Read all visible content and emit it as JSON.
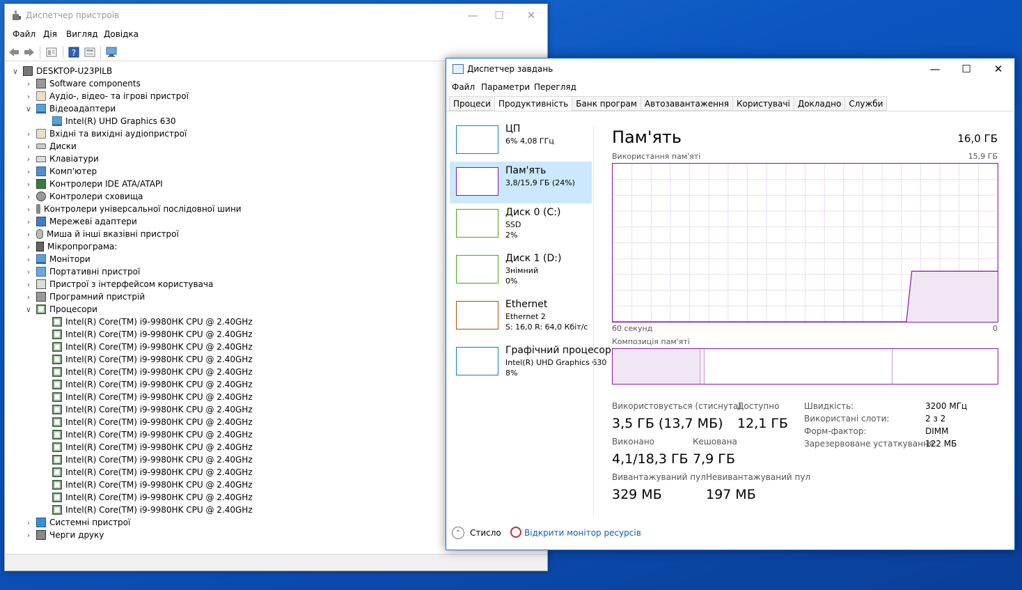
{
  "device_manager": {
    "title": "Диспетчер пристроїв",
    "menu": [
      "Файл",
      "Дія",
      "Вигляд",
      "Довідка"
    ],
    "tree": [
      {
        "label": "DESKTOP-U23PILB",
        "level": 0,
        "expanded": true,
        "icon": "computer-root-icon"
      },
      {
        "label": "Software components",
        "level": 1,
        "expanded": false,
        "icon": "software-components-icon"
      },
      {
        "label": "Аудіо-, відео- та ігрові пристрої",
        "level": 1,
        "expanded": false,
        "icon": "audio-icon"
      },
      {
        "label": "Відеоадаптери",
        "level": 1,
        "expanded": true,
        "icon": "display-adapter-icon"
      },
      {
        "label": "Intel(R) UHD Graphics 630",
        "level": 2,
        "expanded": null,
        "icon": "display-adapter-icon"
      },
      {
        "label": "Вхідні та вихідні аудіопристрої",
        "level": 1,
        "expanded": false,
        "icon": "audio-io-icon"
      },
      {
        "label": "Диски",
        "level": 1,
        "expanded": false,
        "icon": "disk-icon"
      },
      {
        "label": "Клавіатури",
        "level": 1,
        "expanded": false,
        "icon": "keyboard-icon"
      },
      {
        "label": "Комп'ютер",
        "level": 1,
        "expanded": false,
        "icon": "computer-icon"
      },
      {
        "label": "Контролери IDE ATA/ATAPI",
        "level": 1,
        "expanded": false,
        "icon": "ide-icon"
      },
      {
        "label": "Контролери сховища",
        "level": 1,
        "expanded": false,
        "icon": "storage-icon"
      },
      {
        "label": "Контролери універсальної послідовної шини",
        "level": 1,
        "expanded": false,
        "icon": "usb-icon"
      },
      {
        "label": "Мережеві адаптери",
        "level": 1,
        "expanded": false,
        "icon": "network-icon"
      },
      {
        "label": "Миша й інші вказівні пристрої",
        "level": 1,
        "expanded": false,
        "icon": "mouse-icon"
      },
      {
        "label": "Мікропрограма:",
        "level": 1,
        "expanded": false,
        "icon": "firmware-icon"
      },
      {
        "label": "Монітори",
        "level": 1,
        "expanded": false,
        "icon": "monitor-icon"
      },
      {
        "label": "Портативні пристрої",
        "level": 1,
        "expanded": false,
        "icon": "portable-icon"
      },
      {
        "label": "Пристрої з інтерфейсом користувача",
        "level": 1,
        "expanded": false,
        "icon": "hid-icon"
      },
      {
        "label": "Програмний пристрій",
        "level": 1,
        "expanded": false,
        "icon": "software-device-icon"
      },
      {
        "label": "Процесори",
        "level": 1,
        "expanded": true,
        "icon": "processor-icon"
      },
      {
        "label": "Intel(R) Core(TM) i9-9980HK CPU @ 2.40GHz",
        "level": 2,
        "expanded": null,
        "icon": "processor-icon"
      },
      {
        "label": "Intel(R) Core(TM) i9-9980HK CPU @ 2.40GHz",
        "level": 2,
        "expanded": null,
        "icon": "processor-icon"
      },
      {
        "label": "Intel(R) Core(TM) i9-9980HK CPU @ 2.40GHz",
        "level": 2,
        "expanded": null,
        "icon": "processor-icon"
      },
      {
        "label": "Intel(R) Core(TM) i9-9980HK CPU @ 2.40GHz",
        "level": 2,
        "expanded": null,
        "icon": "processor-icon"
      },
      {
        "label": "Intel(R) Core(TM) i9-9980HK CPU @ 2.40GHz",
        "level": 2,
        "expanded": null,
        "icon": "processor-icon"
      },
      {
        "label": "Intel(R) Core(TM) i9-9980HK CPU @ 2.40GHz",
        "level": 2,
        "expanded": null,
        "icon": "processor-icon"
      },
      {
        "label": "Intel(R) Core(TM) i9-9980HK CPU @ 2.40GHz",
        "level": 2,
        "expanded": null,
        "icon": "processor-icon"
      },
      {
        "label": "Intel(R) Core(TM) i9-9980HK CPU @ 2.40GHz",
        "level": 2,
        "expanded": null,
        "icon": "processor-icon"
      },
      {
        "label": "Intel(R) Core(TM) i9-9980HK CPU @ 2.40GHz",
        "level": 2,
        "expanded": null,
        "icon": "processor-icon"
      },
      {
        "label": "Intel(R) Core(TM) i9-9980HK CPU @ 2.40GHz",
        "level": 2,
        "expanded": null,
        "icon": "processor-icon"
      },
      {
        "label": "Intel(R) Core(TM) i9-9980HK CPU @ 2.40GHz",
        "level": 2,
        "expanded": null,
        "icon": "processor-icon"
      },
      {
        "label": "Intel(R) Core(TM) i9-9980HK CPU @ 2.40GHz",
        "level": 2,
        "expanded": null,
        "icon": "processor-icon"
      },
      {
        "label": "Intel(R) Core(TM) i9-9980HK CPU @ 2.40GHz",
        "level": 2,
        "expanded": null,
        "icon": "processor-icon"
      },
      {
        "label": "Intel(R) Core(TM) i9-9980HK CPU @ 2.40GHz",
        "level": 2,
        "expanded": null,
        "icon": "processor-icon"
      },
      {
        "label": "Intel(R) Core(TM) i9-9980HK CPU @ 2.40GHz",
        "level": 2,
        "expanded": null,
        "icon": "processor-icon"
      },
      {
        "label": "Intel(R) Core(TM) i9-9980HK CPU @ 2.40GHz",
        "level": 2,
        "expanded": null,
        "icon": "processor-icon"
      },
      {
        "label": "Системні пристрої",
        "level": 1,
        "expanded": false,
        "icon": "system-devices-icon"
      },
      {
        "label": "Черги друку",
        "level": 1,
        "expanded": false,
        "icon": "print-queue-icon"
      }
    ]
  },
  "task_manager": {
    "title": "Диспетчер завдань",
    "menu": [
      "Файл",
      "Параметри",
      "Перегляд"
    ],
    "tabs": [
      "Процеси",
      "Продуктивність",
      "Банк програм",
      "Автозавантаження",
      "Користувачі",
      "Докладно",
      "Служби"
    ],
    "active_tab": "Продуктивність",
    "sidebar": [
      {
        "name": "ЦП",
        "line1": "6%  4,08 ГГц",
        "line2": "",
        "line3": "",
        "color": "#117dbb",
        "active": false
      },
      {
        "name": "Пам'ять",
        "line1": "3,8/15,9 ГБ (24%)",
        "line2": "",
        "line3": "",
        "color": "#8b12ae",
        "active": true
      },
      {
        "name": "Диск 0 (C:)",
        "line1": "SSD",
        "line2": "2%",
        "line3": "",
        "color": "#4da60c",
        "active": false
      },
      {
        "name": "Диск 1 (D:)",
        "line1": "Знімний",
        "line2": "0%",
        "line3": "",
        "color": "#4da60c",
        "active": false
      },
      {
        "name": "Ethernet",
        "line1": "Ethernet 2",
        "line2": "S: 16,0  R: 64,0 Кбіт/с",
        "line3": "",
        "color": "#a74f01",
        "active": false
      },
      {
        "name": "Графічний процесор",
        "line1": "Intel(R) UHD Graphics 630",
        "line2": "8%",
        "line3": "",
        "color": "#117dbb",
        "active": false
      }
    ],
    "memory": {
      "title": "Пам'ять",
      "total": "16,0 ГБ",
      "usage_label": "Використання пам'яті",
      "usage_max": "15,9 ГБ",
      "axis_left": "60 секунд",
      "axis_right": "0",
      "composition_label": "Композиція пам'яті",
      "usage_fraction": 0.32,
      "stats": [
        {
          "label": "Використовується (стиснута)",
          "value": "3,5 ГБ (13,7 МБ)"
        },
        {
          "label": "Доступно",
          "value": "12,1 ГБ"
        },
        {
          "label": "Виконано",
          "value": "4,1/18,3 ГБ"
        },
        {
          "label": "Кешована",
          "value": "7,9 ГБ"
        },
        {
          "label": "Вивантажуваний пул",
          "value": "329 МБ"
        },
        {
          "label": "Невивантажуваний пул",
          "value": "197 МБ"
        }
      ],
      "specs": [
        {
          "label": "Швидкість:",
          "value": "3200 МГц"
        },
        {
          "label": "Використані слоти:",
          "value": "2 з 2"
        },
        {
          "label": "Форм-фактор:",
          "value": "DIMM"
        },
        {
          "label": "Зарезервоване устаткування:",
          "value": "122 МБ"
        }
      ]
    },
    "footer": {
      "fewer_details": "Стисло",
      "resource_monitor": "Відкрити монітор ресурсів"
    }
  }
}
